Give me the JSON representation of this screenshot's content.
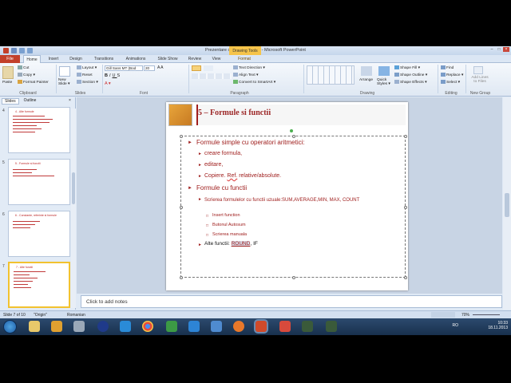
{
  "window": {
    "title": "Prezentare curs - Excel.pptx - Microsoft PowerPoint",
    "context_tab": "Drawing Tools",
    "controls": [
      "–",
      "□",
      "×"
    ]
  },
  "tabs": {
    "file": "File",
    "home": "Home",
    "insert": "Insert",
    "design": "Design",
    "transitions": "Transitions",
    "animations": "Animations",
    "slideshow": "Slide Show",
    "review": "Review",
    "view": "View",
    "format": "Format"
  },
  "ribbon": {
    "clipboard": {
      "paste": "Paste",
      "cut": "Cut",
      "copy": "Copy ▾",
      "format_painter": "Format Painter",
      "label": "Clipboard"
    },
    "slides": {
      "new_slide": "New Slide ▾",
      "layout": "Layout ▾",
      "reset": "Reset",
      "section": "Section ▾",
      "label": "Slides"
    },
    "font": {
      "family": "Gill Sans MT (Bod",
      "size": "20",
      "label": "Font"
    },
    "paragraph": {
      "text_direction": "Text Direction ▾",
      "align_text": "Align Text ▾",
      "convert_smartart": "Convert to SmartArt ▾",
      "label": "Paragraph"
    },
    "drawing": {
      "arrange": "Arrange",
      "quick_styles": "Quick Styles ▾",
      "shape_fill": "Shape Fill ▾",
      "shape_outline": "Shape Outline ▾",
      "shape_effects": "Shape Effects ▾",
      "label": "Drawing"
    },
    "editing": {
      "find": "Find",
      "replace": "Replace ▾",
      "select": "Select ▾",
      "label": "Editing"
    },
    "newgroup": {
      "add_lines": "Add Lines to Files",
      "label": "New Group"
    }
  },
  "pane": {
    "tab_slides": "Slides",
    "tab_outline": "Outline"
  },
  "thumbnails": [
    {
      "num": "4",
      "title": "4 - Alte formule"
    },
    {
      "num": "5",
      "title": "5 - Formule si functii"
    },
    {
      "num": "6",
      "title": "6 - Constante, referinte si formule"
    },
    {
      "num": "7",
      "title": "7 - Alte functii"
    }
  ],
  "slide": {
    "title": "5 – Formule si functii",
    "b1": "Formule simple cu operatori aritmetici:",
    "b1_1": "creare formula,",
    "b1_2": "editare,",
    "b1_3_pre": "Copiere. ",
    "b1_3_ref": "Ref.",
    "b1_3_post": " relative/absolute.",
    "b2": "Formule cu functii",
    "b2_1": "Scrierea formulelor cu functii uzuale:SUM,AVERAGE,MIN, MAX, COUNT",
    "b2_1_a": "Insert function",
    "b2_1_b": "Butonul Autosum",
    "b2_1_c": "Scrierea manuala",
    "b2_2_pre": "Alte functii: ",
    "b2_2_round": "ROUND",
    "b2_2_post": ", IF"
  },
  "notes": {
    "placeholder": "Click to add notes"
  },
  "status": {
    "slide": "Slide 7 of 10",
    "theme": "\"Origin\"",
    "language": "Romanian",
    "zoom": "70%"
  },
  "tray": {
    "lang": "RO",
    "time": "10:33",
    "date": "18.11.2013"
  },
  "colors": {
    "accent": "#a0201f",
    "file_tab": "#c2402a",
    "context": "#f6c44a"
  }
}
